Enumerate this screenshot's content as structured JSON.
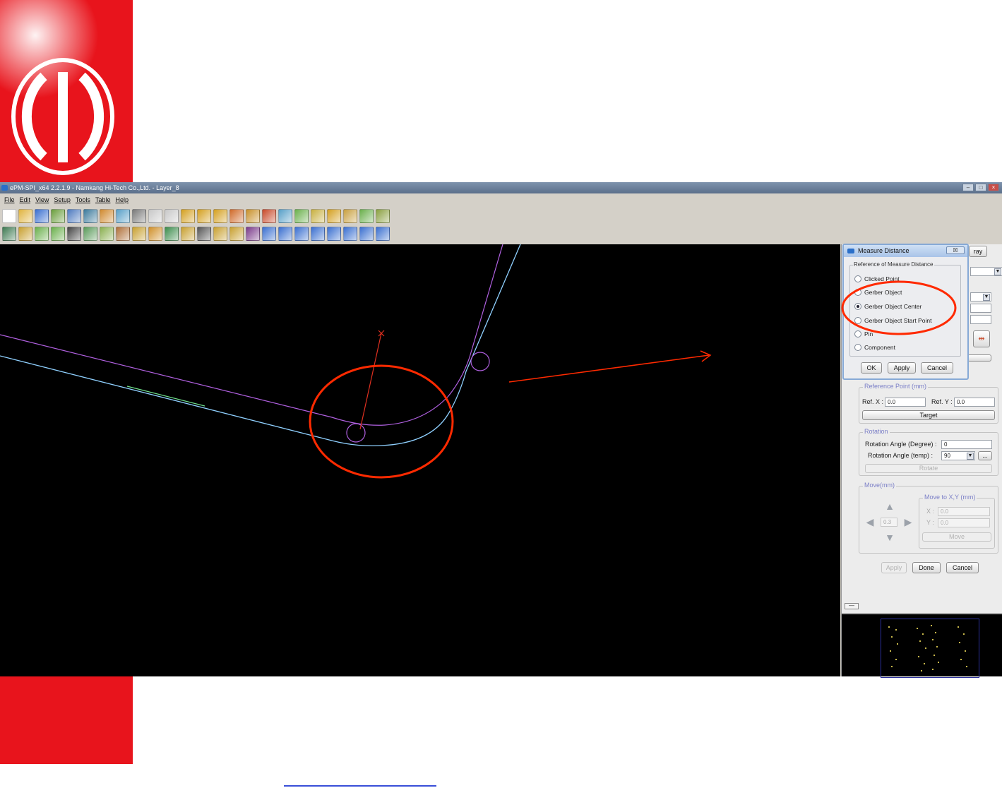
{
  "window": {
    "title": "ePM-SPI_x64 2.2.1.9 - Namkang Hi-Tech Co.,Ltd. - Layer_8",
    "controls": [
      "–",
      "□",
      "×"
    ]
  },
  "menu": [
    "File",
    "Edit",
    "View",
    "Setup",
    "Tools",
    "Table",
    "Help"
  ],
  "toolbar1_colors": [
    "#ffffff",
    "#e0b440",
    "#3a6fd0",
    "#6a9e3c",
    "#4f7bc0",
    "#3c7a9c",
    "#d08a30",
    "#58a0c8",
    "#7a7a7a",
    "#c8c8c8",
    "#c8c8c8",
    "#d4a020",
    "#d4a020",
    "#d4a020",
    "#d06a2a",
    "#c8902a",
    "#c84a2a",
    "#58a0c8",
    "#6ab04c",
    "#c8b040",
    "#d4a020",
    "#c8a040",
    "#6ab04c",
    "#8aa040"
  ],
  "toolbar2_colors": [
    "#3f7a52",
    "#c8a030",
    "#6ab04c",
    "#6ab04c",
    "#444444",
    "#5a9a5a",
    "#8ab050",
    "#b0703a",
    "#c8a030",
    "#d0902a",
    "#3c8c4c",
    "#c8a030",
    "#555555",
    "#c8a030",
    "#c8a030",
    "#7a3a8a",
    "#3a6fd0",
    "#3a6fd0",
    "#3a6fd0",
    "#3a6fd0",
    "#3a6fd0",
    "#3a6fd0",
    "#3a6fd0",
    "#3a6fd0"
  ],
  "dialog": {
    "title": "Measure Distance",
    "close": "☒",
    "group_title": "Reference of Measure Distance",
    "options": [
      {
        "label": "Clicked Point",
        "checked": false
      },
      {
        "label": "Gerber Object",
        "checked": false
      },
      {
        "label": "Gerber Object Center",
        "checked": true
      },
      {
        "label": "Gerber Object Start Point",
        "checked": false
      },
      {
        "label": "Pin",
        "checked": false
      },
      {
        "label": "Component",
        "checked": false
      }
    ],
    "ok": "OK",
    "apply": "Apply",
    "cancel": "Cancel"
  },
  "panel": {
    "tab_label": "ray",
    "reference_point": {
      "title": "Reference Point (mm)",
      "ref_x_label": "Ref. X :",
      "ref_x": "0.0",
      "ref_y_label": "Ref. Y :",
      "ref_y": "0.0",
      "target": "Target"
    },
    "rotation": {
      "title": "Rotation",
      "angle_label": "Rotation Angle (Degree) :",
      "angle": "0",
      "temp_label": "Rotation Angle (temp) :",
      "temp": "90",
      "more": "...",
      "rotate": "Rotate"
    },
    "move": {
      "title": "Move(mm)",
      "step": "0.3",
      "move_to_title": "Move to X,Y (mm)",
      "x_label": "X :",
      "x": "0.0",
      "y_label": "Y :",
      "y": "0.0",
      "move": "Move"
    },
    "apply": "Apply",
    "done": "Done",
    "cancel": "Cancel",
    "collapse": "—"
  },
  "colors": {
    "brand_red": "#e8141c",
    "annotation": "#ff2a00",
    "trace_blue": "#8fd0ff",
    "trace_purple": "#b060e0"
  }
}
